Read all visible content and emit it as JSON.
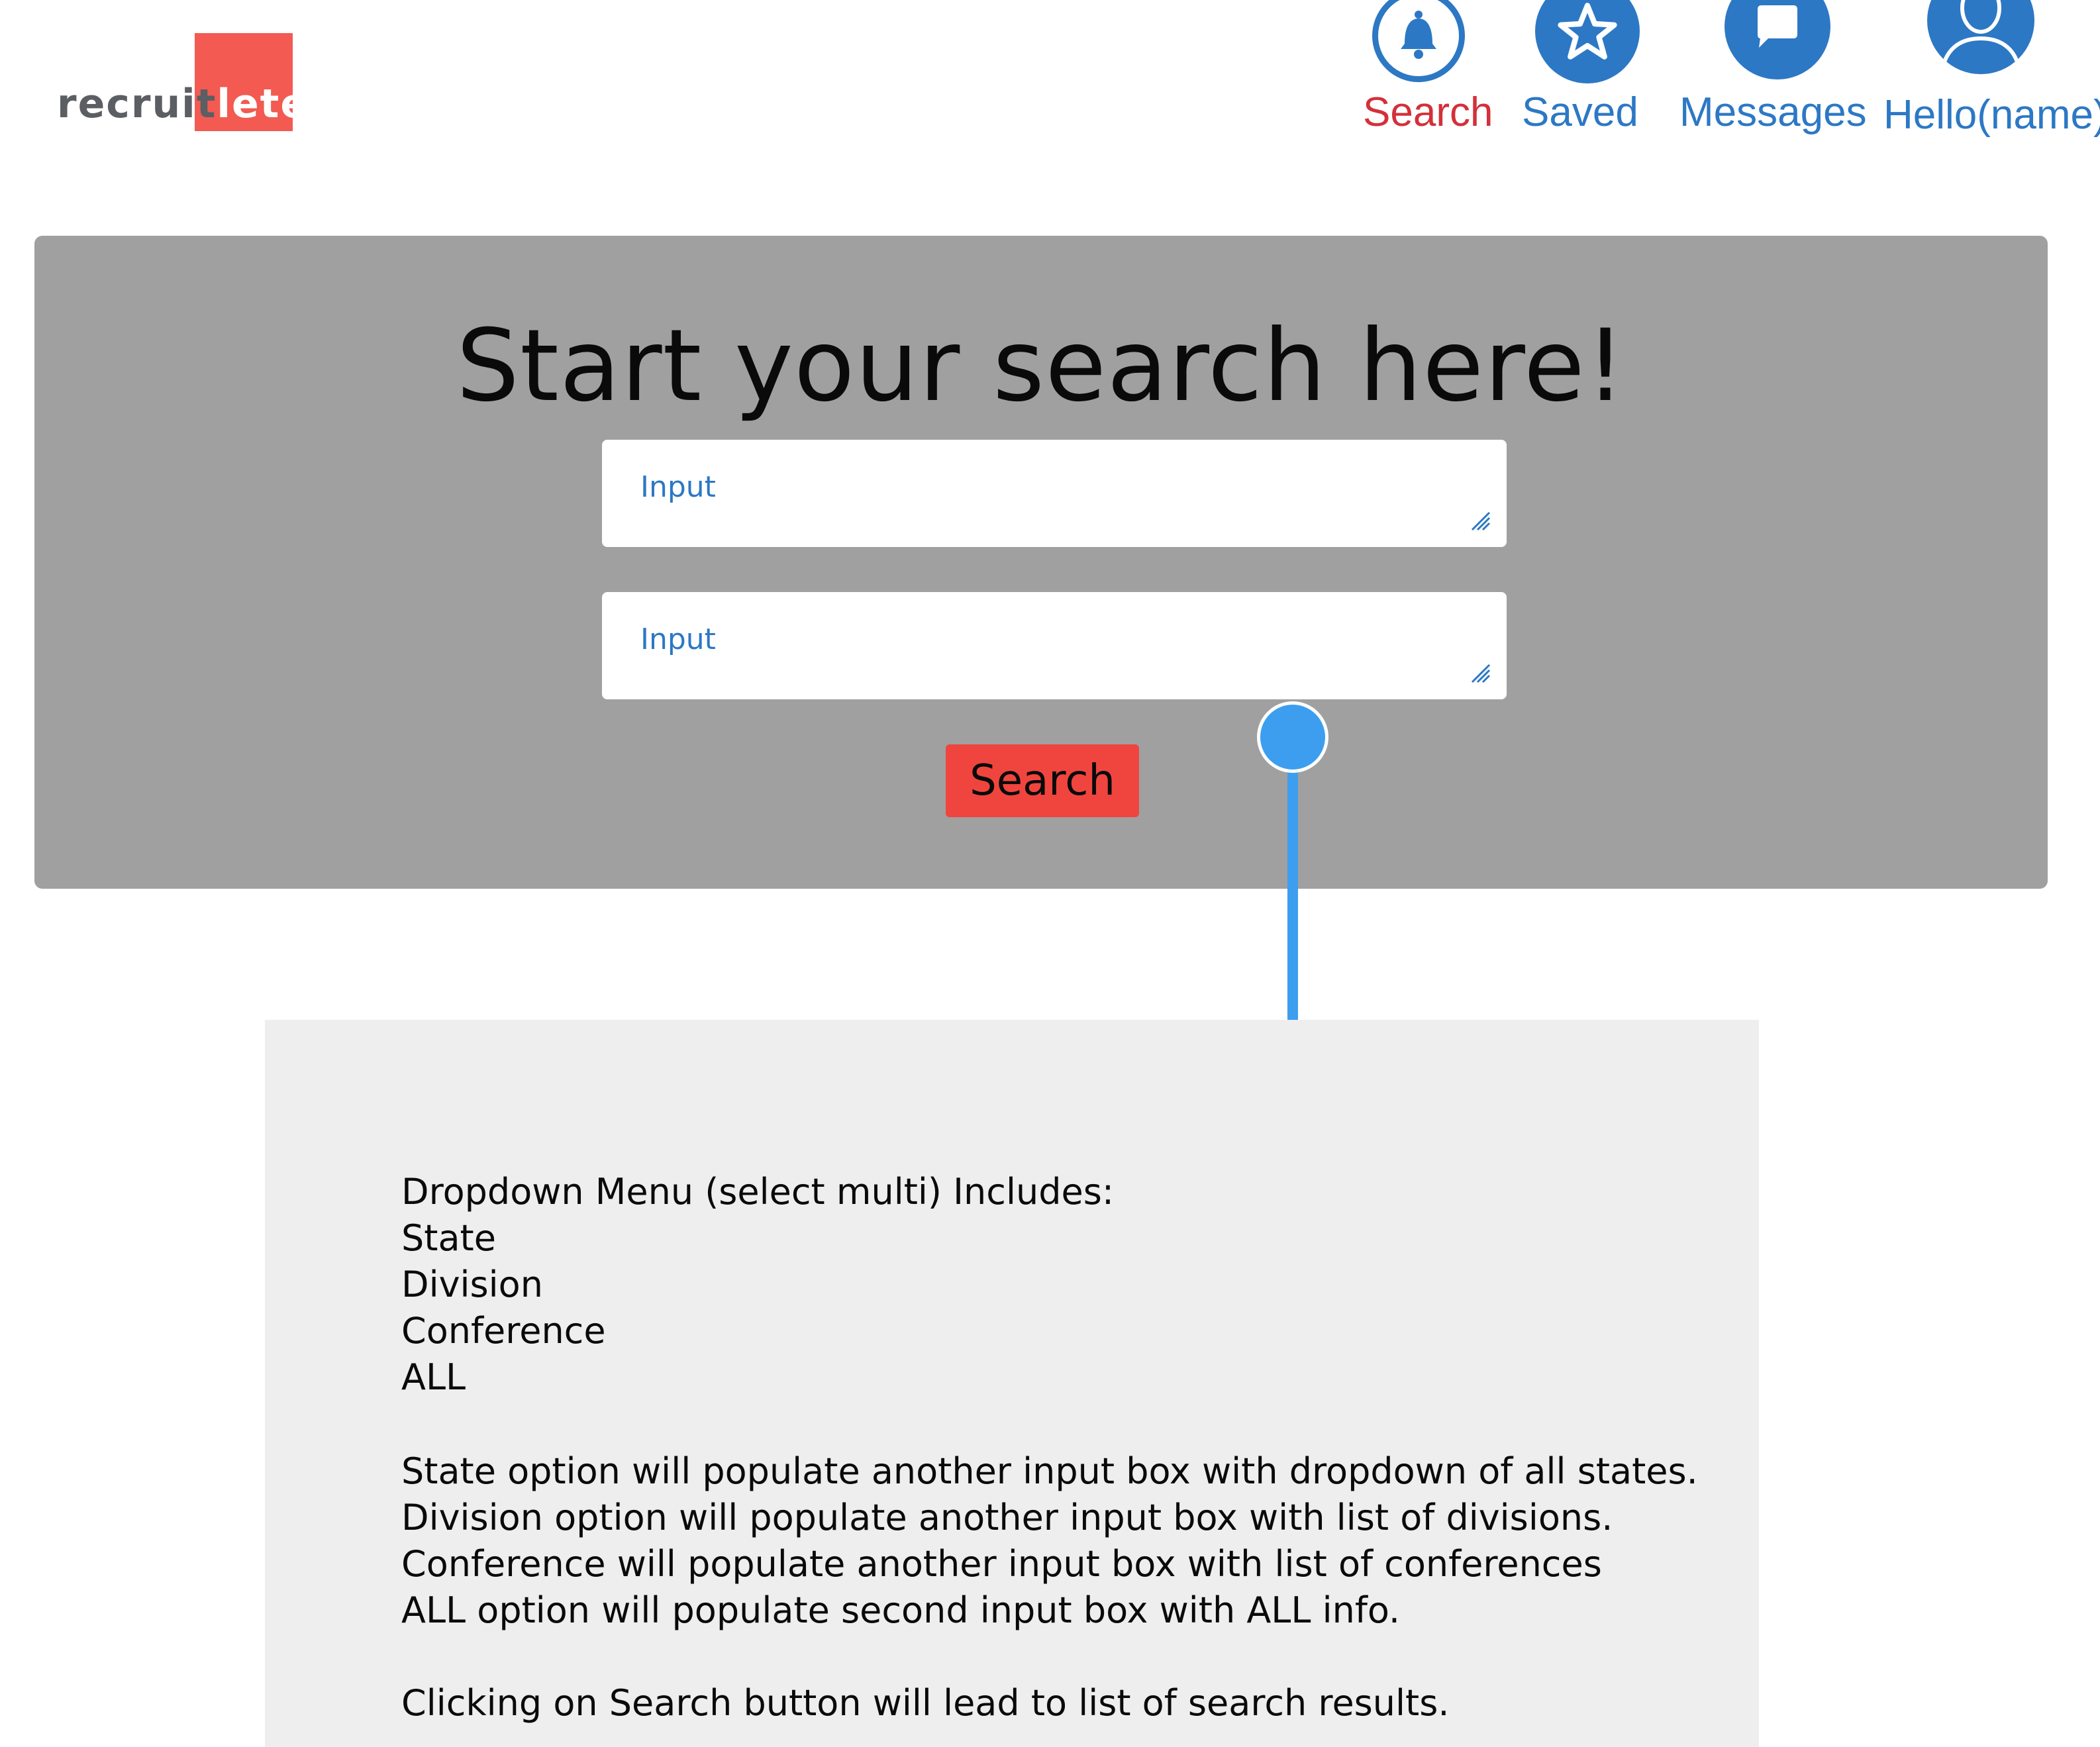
{
  "logo": {
    "part1": "recruit",
    "part2": "lete"
  },
  "nav": [
    {
      "label": "Search",
      "icon": "bell-icon",
      "color": "#d3303a"
    },
    {
      "label": "Saved",
      "icon": "star-icon",
      "color": "#2c78c4"
    },
    {
      "label": "Messages",
      "icon": "message-icon",
      "color": "#2c78c4"
    },
    {
      "label": "Hello(name)",
      "icon": "user-icon",
      "color": "#2c78c4"
    }
  ],
  "hero": {
    "title": "Start your search here!",
    "inputs": [
      {
        "placeholder": "Input"
      },
      {
        "placeholder": "Input"
      }
    ],
    "button_label": "Search"
  },
  "notes": {
    "lines": [
      "Dropdown Menu (select multi) Includes:",
      "State",
      "Division",
      "Conference",
      "ALL",
      "State option will populate another input box with dropdown of all states.",
      "Division option will populate another input box with list of divisions.",
      "Conference will populate another input box with list of conferences",
      "ALL option will populate second input box with ALL info.",
      "Clicking on Search button will lead to list of search results."
    ]
  },
  "colors": {
    "accent_red": "#f0453e",
    "brand_blue": "#2c78c4",
    "connector_blue": "#3d9ef0",
    "panel_gray": "#a0a0a0",
    "notes_bg": "#eeeeee"
  }
}
